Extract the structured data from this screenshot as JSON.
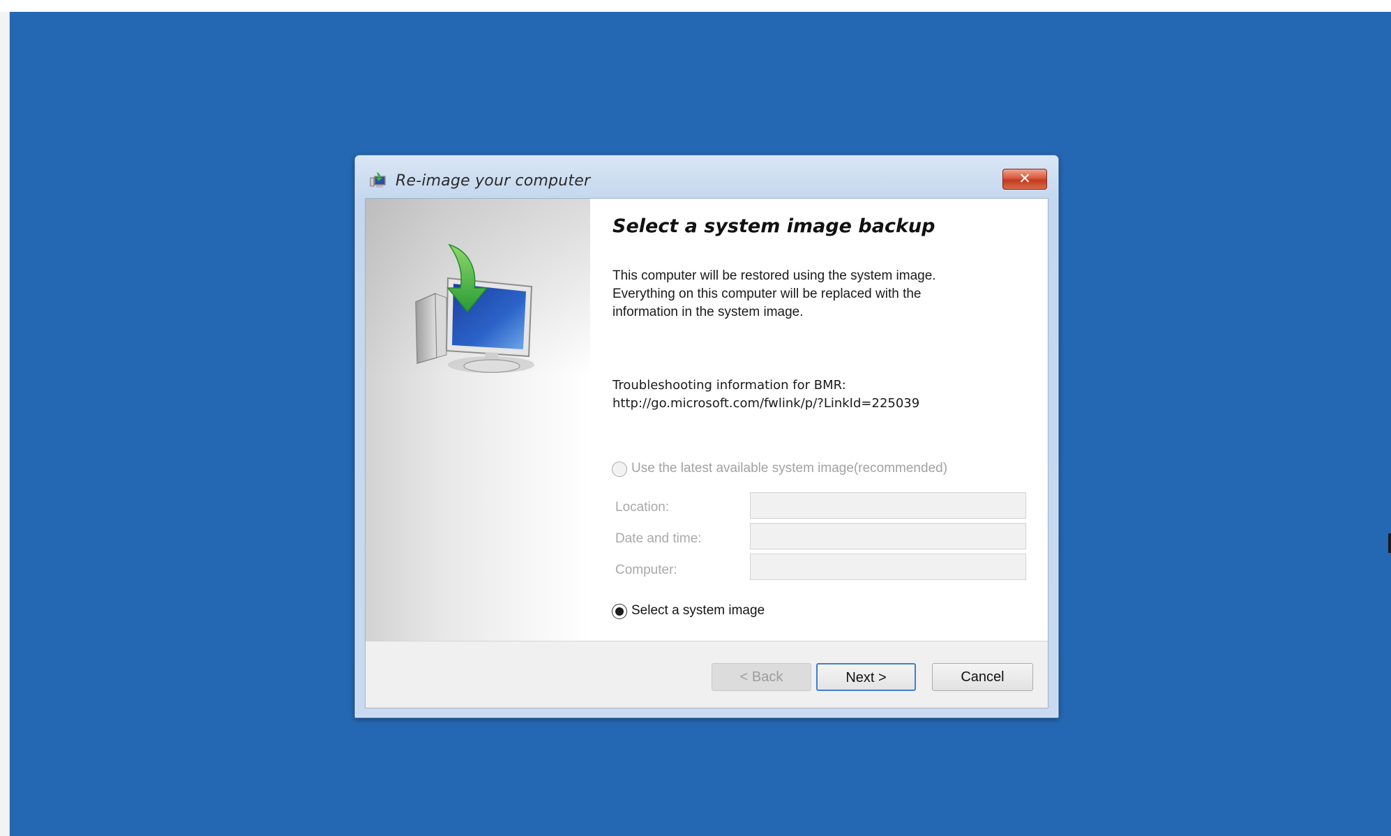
{
  "dialog": {
    "title": "Re-image your computer",
    "close_glyph": "✕",
    "heading": "Select a system image backup",
    "description": "This computer will be restored using the system image. Everything on this computer will be replaced with the information in the system image.",
    "troubleshooting_label": "Troubleshooting information for BMR:",
    "troubleshooting_link": "http://go.microsoft.com/fwlink/p/?LinkId=225039",
    "option_latest": {
      "label": "Use the latest available system image(recommended)",
      "selected": false,
      "enabled": false
    },
    "fields": [
      {
        "label": "Location:",
        "value": ""
      },
      {
        "label": "Date and time:",
        "value": ""
      },
      {
        "label": "Computer:",
        "value": ""
      }
    ],
    "option_select": {
      "label": "Select a system image",
      "selected": true
    },
    "buttons": {
      "back": "< Back",
      "next": "Next >",
      "cancel": "Cancel"
    }
  },
  "colors": {
    "desktop_background": "#2468b3",
    "close_button": "#c13b1f",
    "default_button_border": "#3f7fd0"
  }
}
